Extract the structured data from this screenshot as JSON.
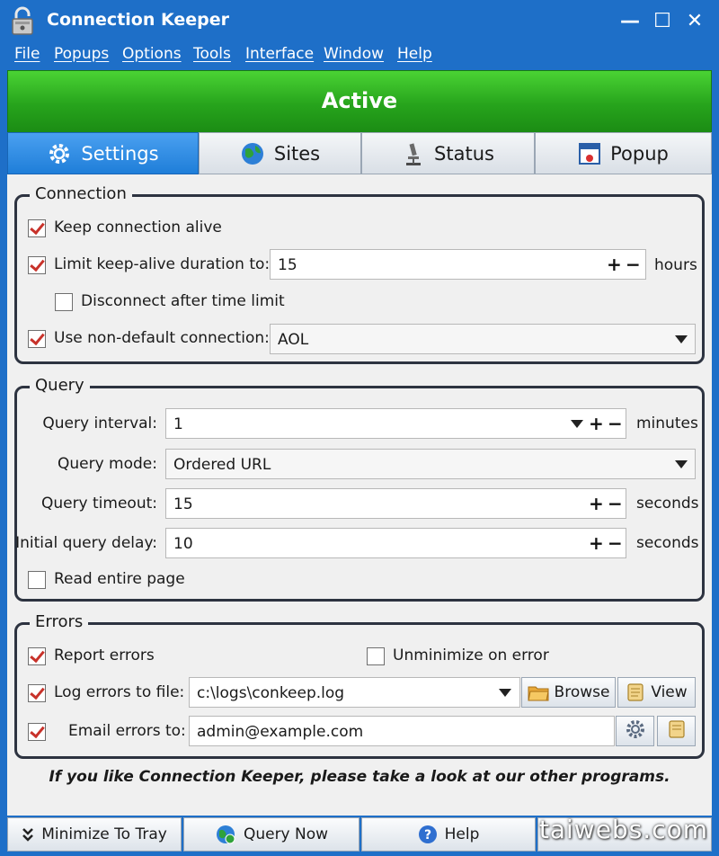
{
  "window": {
    "title": "Connection Keeper",
    "controls": [
      "—",
      "☐",
      "✕"
    ]
  },
  "menu": [
    "File",
    "Popups",
    "Options",
    "Tools",
    "Interface",
    "Window",
    "Help"
  ],
  "status": {
    "label": "Active",
    "color": "#2aa81f"
  },
  "tabs": [
    {
      "label": "Settings",
      "icon": "gear-icon",
      "active": true
    },
    {
      "label": "Sites",
      "icon": "globe-icon",
      "active": false
    },
    {
      "label": "Status",
      "icon": "microscope-icon",
      "active": false
    },
    {
      "label": "Popup",
      "icon": "popup-window-icon",
      "active": false
    }
  ],
  "connection": {
    "title": "Connection",
    "keep_alive": {
      "label": "Keep connection alive",
      "checked": true
    },
    "limit_duration": {
      "label": "Limit keep-alive duration to:",
      "checked": true,
      "value": "15",
      "unit": "hours"
    },
    "disconnect_after": {
      "label": "Disconnect after time limit",
      "checked": false
    },
    "non_default": {
      "label": "Use non-default connection:",
      "checked": true,
      "value": "AOL"
    }
  },
  "query": {
    "title": "Query",
    "interval": {
      "label": "Query interval:",
      "value": "1",
      "unit": "minutes"
    },
    "mode": {
      "label": "Query mode:",
      "value": "Ordered URL"
    },
    "timeout": {
      "label": "Query timeout:",
      "value": "15",
      "unit": "seconds"
    },
    "initial_delay": {
      "label": "Initial query delay:",
      "value": "10",
      "unit": "seconds"
    },
    "read_entire": {
      "label": "Read entire page",
      "checked": false
    }
  },
  "errors": {
    "title": "Errors",
    "report": {
      "label": "Report errors",
      "checked": true
    },
    "unminimize": {
      "label": "Unminimize on error",
      "checked": false
    },
    "log_file": {
      "label": "Log errors to file:",
      "checked": true,
      "value": "c:\\logs\\conkeep.log",
      "browse_label": "Browse",
      "view_label": "View"
    },
    "email": {
      "label": "Email errors to:",
      "checked": true,
      "value": "admin@example.com"
    }
  },
  "promo_text": "If you like Connection Keeper, please take a look at our other programs.",
  "bottom": {
    "minimize_label": "Minimize To Tray",
    "query_now_label": "Query Now",
    "help_label": "Help"
  },
  "watermark": "taiwebs.com",
  "spin_plus": "+",
  "spin_minus": "−"
}
